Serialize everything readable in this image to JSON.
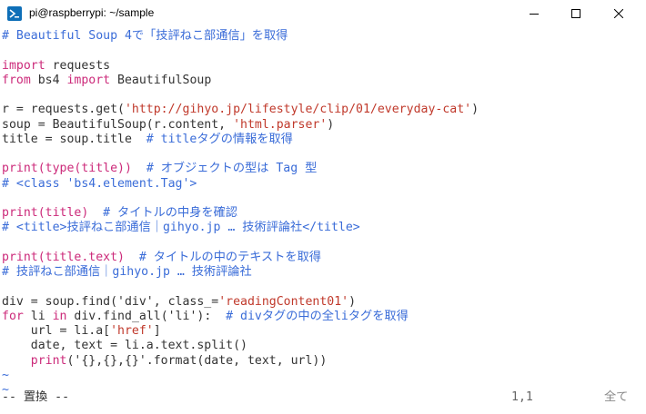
{
  "window": {
    "title": "pi@raspberrypi: ~/sample",
    "app_icon": "powershell-terminal-icon",
    "controls": [
      "minimize-icon",
      "maximize-icon",
      "close-icon"
    ]
  },
  "colors": {
    "comment": "#3a6cd8",
    "keyword": "#cc2a7a",
    "string": "#c0392b",
    "text": "#333333",
    "tilde": "#3a6cd8"
  },
  "code_lines": [
    [
      {
        "t": "# Beautiful Soup 4で「技評ねこ部通信」を取得",
        "c": "comment"
      }
    ],
    [],
    [
      {
        "t": "import",
        "c": "keyword"
      },
      {
        "t": " requests",
        "c": "text"
      }
    ],
    [
      {
        "t": "from",
        "c": "keyword"
      },
      {
        "t": " bs4 ",
        "c": "text"
      },
      {
        "t": "import",
        "c": "keyword"
      },
      {
        "t": " BeautifulSoup",
        "c": "text"
      }
    ],
    [],
    [
      {
        "t": "r = requests.get(",
        "c": "text"
      },
      {
        "t": "'http://gihyo.jp/lifestyle/clip/01/everyday-cat'",
        "c": "string"
      },
      {
        "t": ")",
        "c": "text"
      }
    ],
    [
      {
        "t": "soup = BeautifulSoup(r.content, ",
        "c": "text"
      },
      {
        "t": "'html.parser'",
        "c": "string"
      },
      {
        "t": ")",
        "c": "text"
      }
    ],
    [
      {
        "t": "title = soup.title  ",
        "c": "text"
      },
      {
        "t": "# titleタグの情報を取得",
        "c": "comment"
      }
    ],
    [],
    [
      {
        "t": "print(type(title))",
        "c": "keyword"
      },
      {
        "t": "  ",
        "c": "text"
      },
      {
        "t": "# オブジェクトの型は Tag 型",
        "c": "comment"
      }
    ],
    [
      {
        "t": "# <class 'bs4.element.Tag'>",
        "c": "comment"
      }
    ],
    [],
    [
      {
        "t": "print(title)",
        "c": "keyword"
      },
      {
        "t": "  ",
        "c": "text"
      },
      {
        "t": "# タイトルの中身を確認",
        "c": "comment"
      }
    ],
    [
      {
        "t": "# <title>技評ねこ部通信｜gihyo.jp … 技術評論社</title>",
        "c": "comment"
      }
    ],
    [],
    [
      {
        "t": "print(title.text)",
        "c": "keyword"
      },
      {
        "t": "  ",
        "c": "text"
      },
      {
        "t": "# タイトルの中のテキストを取得",
        "c": "comment"
      }
    ],
    [
      {
        "t": "# 技評ねこ部通信｜gihyo.jp … 技術評論社",
        "c": "comment"
      }
    ],
    [],
    [
      {
        "t": "div = soup.find('div', class_=",
        "c": "text"
      },
      {
        "t": "'readingContent01'",
        "c": "string"
      },
      {
        "t": ")",
        "c": "text"
      }
    ],
    [
      {
        "t": "for",
        "c": "keyword"
      },
      {
        "t": " li ",
        "c": "text"
      },
      {
        "t": "in",
        "c": "keyword"
      },
      {
        "t": " div.find_all('li'):  ",
        "c": "text"
      },
      {
        "t": "# divタグの中の全liタグを取得",
        "c": "comment"
      }
    ],
    [
      {
        "t": "    url = li.a[",
        "c": "text"
      },
      {
        "t": "'href'",
        "c": "string"
      },
      {
        "t": "]",
        "c": "text"
      }
    ],
    [
      {
        "t": "    date, text = li.a.text.split()",
        "c": "text"
      }
    ],
    [
      {
        "t": "    ",
        "c": "text"
      },
      {
        "t": "print",
        "c": "keyword"
      },
      {
        "t": "('{},{},{}'.format(date, text, url))",
        "c": "text"
      }
    ]
  ],
  "tildes": [
    "~",
    "~"
  ],
  "status": {
    "mode": "-- 置換 --",
    "position": "1,1",
    "scroll": "全て"
  }
}
